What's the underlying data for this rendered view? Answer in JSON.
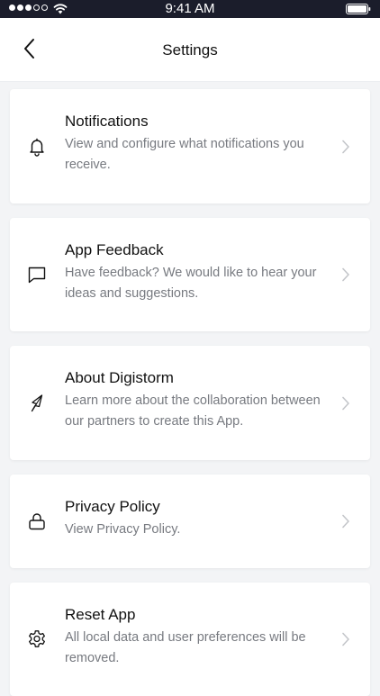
{
  "status_bar": {
    "time": "9:41 AM"
  },
  "nav": {
    "title": "Settings"
  },
  "items": [
    {
      "title": "Notifications",
      "description": "View and configure what notifications you receive.",
      "icon": "bell-icon"
    },
    {
      "title": "App Feedback",
      "description": "Have feedback? We would like to hear your ideas and suggestions.",
      "icon": "chat-bubble-icon"
    },
    {
      "title": "About Digistorm",
      "description": "Learn more about the collaboration between our partners to create this App.",
      "icon": "digistorm-logo-icon"
    },
    {
      "title": "Privacy Policy",
      "description": "View Privacy Policy.",
      "icon": "lock-icon"
    },
    {
      "title": "Reset App",
      "description": "All local data and user preferences will be removed.",
      "icon": "gear-icon"
    }
  ],
  "colors": {
    "status_bar_bg": "#1b1d2b",
    "page_bg": "#f3f4f6",
    "card_bg": "#ffffff",
    "description_text": "#777a80",
    "chevron": "#c4c6ca"
  }
}
